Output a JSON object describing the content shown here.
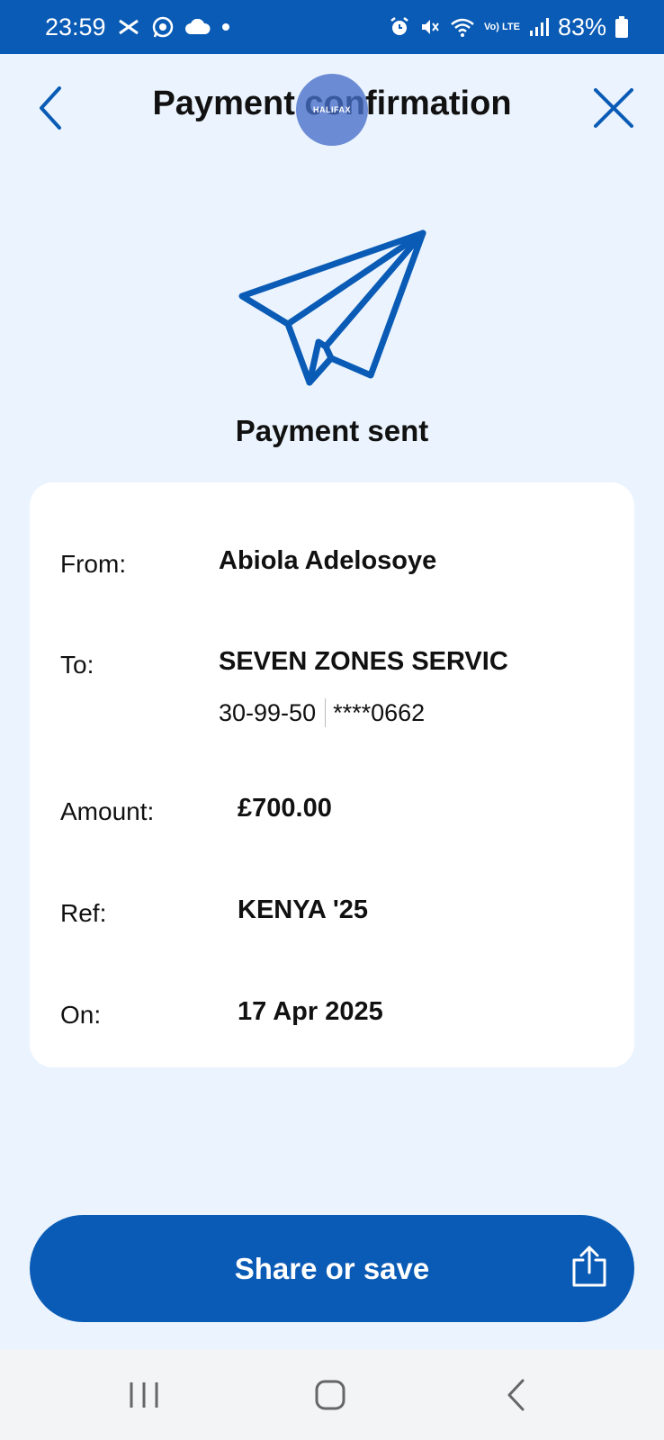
{
  "status_bar": {
    "time": "23:59",
    "battery": "83%",
    "network_label": "Vo) LTE",
    "left_icons": [
      "halifax-notification-icon",
      "whatsapp-icon",
      "cloud-icon",
      "dot-icon"
    ],
    "right_icons": [
      "alarm-icon",
      "mute-icon",
      "wifi-icon",
      "volte-icon",
      "signal-icon",
      "battery-icon"
    ]
  },
  "header": {
    "title": "Payment confirmation",
    "back_icon": "chevron-left-icon",
    "close_icon": "close-icon",
    "overlay_logo_text": "HALIFAX"
  },
  "confirmation": {
    "icon": "paper-plane-icon",
    "title": "Payment sent"
  },
  "details": {
    "from_label": "From:",
    "from_value": "Abiola Adelosoye",
    "to_label": "To:",
    "to_value": "SEVEN ZONES SERVIC",
    "sort_code": "30-99-50",
    "account_number": "****0662",
    "amount_label": "Amount:",
    "amount_value": "£700.00",
    "ref_label": "Ref:",
    "ref_value": "KENYA '25",
    "on_label": "On:",
    "on_value": "17 Apr 2025"
  },
  "share_button": {
    "label": "Share or save",
    "icon": "share-icon"
  },
  "nav_bar": {
    "icons": [
      "recent-apps-icon",
      "home-icon",
      "back-icon"
    ]
  },
  "colors": {
    "brand_blue": "#0a5bb5",
    "page_background": "#ebf4fe",
    "card_background": "#ffffff"
  }
}
